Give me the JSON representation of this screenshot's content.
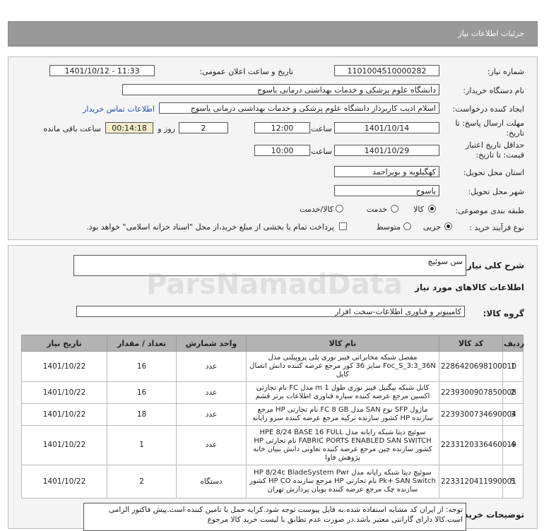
{
  "header": {
    "title": "جزئیات اطلاعات نیاز"
  },
  "form": {
    "need_number_label": "شماره نیاز:",
    "need_number": "1101004510000282",
    "announce_label": "تاریخ و ساعت اعلان عمومی:",
    "announce_value": "1401/10/12 - 11:33",
    "buyer_org_label": "نام دستگاه خریدار:",
    "buyer_org": "دانشگاه علوم پزشکی و خدمات بهداشتی  درمانی یاسوج",
    "requester_label": "ایجاد کننده درخواست:",
    "requester": "اسلام  ادیب کاربرداز دانشگاه علوم پزشکی و خدمات بهداشتی  درمانی یاسوج",
    "buyer_contact_link": "اطلاعات تماس خریدار",
    "deadline_label": "مهلت ارسال پاسخ: تا تاریخ:",
    "deadline_date": "1401/10/14",
    "time_label": "ساعت",
    "deadline_time": "12:00",
    "days_value": "2",
    "days_label": "روز و",
    "remaining_value": "00:14:18",
    "remaining_label": "ساعت باقی مانده",
    "validity_label": "حداقل تاریخ اعتبار قیمت: تا تاریخ:",
    "validity_date": "1401/10/29",
    "validity_time_label": "ساعت",
    "validity_time": "10:00",
    "province_label": "استان محل تحویل:",
    "province": "کهگیلویه و بویراحمد",
    "city_label": "شهر محل تحویل:",
    "city": "یاسوج",
    "category_label": "طبقه بندی موضوعی:",
    "category_options": [
      "کالا",
      "خدمت",
      "کالا/خدمت"
    ],
    "process_label": "نوع فرآیند خرید :",
    "process_options": [
      "جزیی",
      "متوسط"
    ],
    "payment_text": "پرداخت تمام یا بخشی از مبلغ خرید،از محل \"اسناد خزانه اسلامی\" خواهد بود."
  },
  "summary": {
    "general_desc_label": "شرح کلی نیاز:",
    "general_desc": "سن سوئیچ",
    "goods_info_title": "اطلاعات کالاهای مورد نیاز",
    "goods_group_label": "گروه کالا:",
    "goods_group": "کامپیوتر و فناوری اطلاعات-سخت افزار"
  },
  "table": {
    "headers": [
      "ردیف",
      "کد کالا",
      "نام کالا",
      "واحد شمارش",
      "تعداد / مقدار",
      "تاریخ نیاز"
    ],
    "rows": [
      {
        "row": "1",
        "code": "2286420698100010",
        "name": "مفصل شبکه مخابراتی فیبر نوری پلی پروپیلنی مدل Foc_S_3:3_36N سایز 36 کور مرجع عرضه کننده دانش اتصال کابل",
        "unit": "عدد",
        "qty": "16",
        "date": "1401/10/22"
      },
      {
        "row": "2",
        "code": "2239300907850008",
        "name": "کابل شبکه پیگتیل فیبر نوری طول 1 m مدل FC نام تجارتی اکسین مرجع عرضه کننده سیاره فناوری اطلاعات برتر قشم",
        "unit": "عدد",
        "qty": "16",
        "date": "1401/10/22"
      },
      {
        "row": "3",
        "code": "2239300734690004",
        "name": "ماژول SFP نوع SAN مدل FC 8 GB نام تجارتی HP مرجع سازنده HP کشور سازنده ترکیه مرجع عرضه کننده سرو رایانه",
        "unit": "عدد",
        "qty": "18",
        "date": "1401/10/22"
      },
      {
        "row": "4",
        "code": "2233120336460019",
        "name": "سوئیچ دیتا شبکه رایانه مدل HPE 8/24 BASE 16 FULL FABRIC PORTS ENABLED SAN SWITCH نام تجارتی HP کشور سازنده چین مرجع عرضه کننده تعاونی دانش بنیان خانه پژوهش فاوا",
        "unit": "عدد",
        "qty": "1",
        "date": "1401/10/22"
      },
      {
        "row": "5",
        "code": "2233120411990001",
        "name": "سوئیچ دیتا شبکه رایانه مدل HP 8/24c BladeSystem Pwr Pk+ SAN Switch نام تجارتی HP مرجع سازنده HP CO کشور سازنده چک مرجع عرضه کننده پویان پردازش تهران",
        "unit": "دستگاه",
        "qty": "2",
        "date": "1401/10/22"
      }
    ]
  },
  "note": {
    "text": "توجه: از ایران کد مشابه استفاده شده.به فایل پیوست توجه شود.کرایه حمل با تامین کننده است.پیش فاکتور الزامی است.کالا دارای گارانتی معتبر باشد.در صورت عدم تطابق با لیست خرید کالا مرجوع",
    "buyer_desc_label": "توضیحات خریدار:"
  },
  "watermark": {
    "text": "ParsNamadData"
  }
}
